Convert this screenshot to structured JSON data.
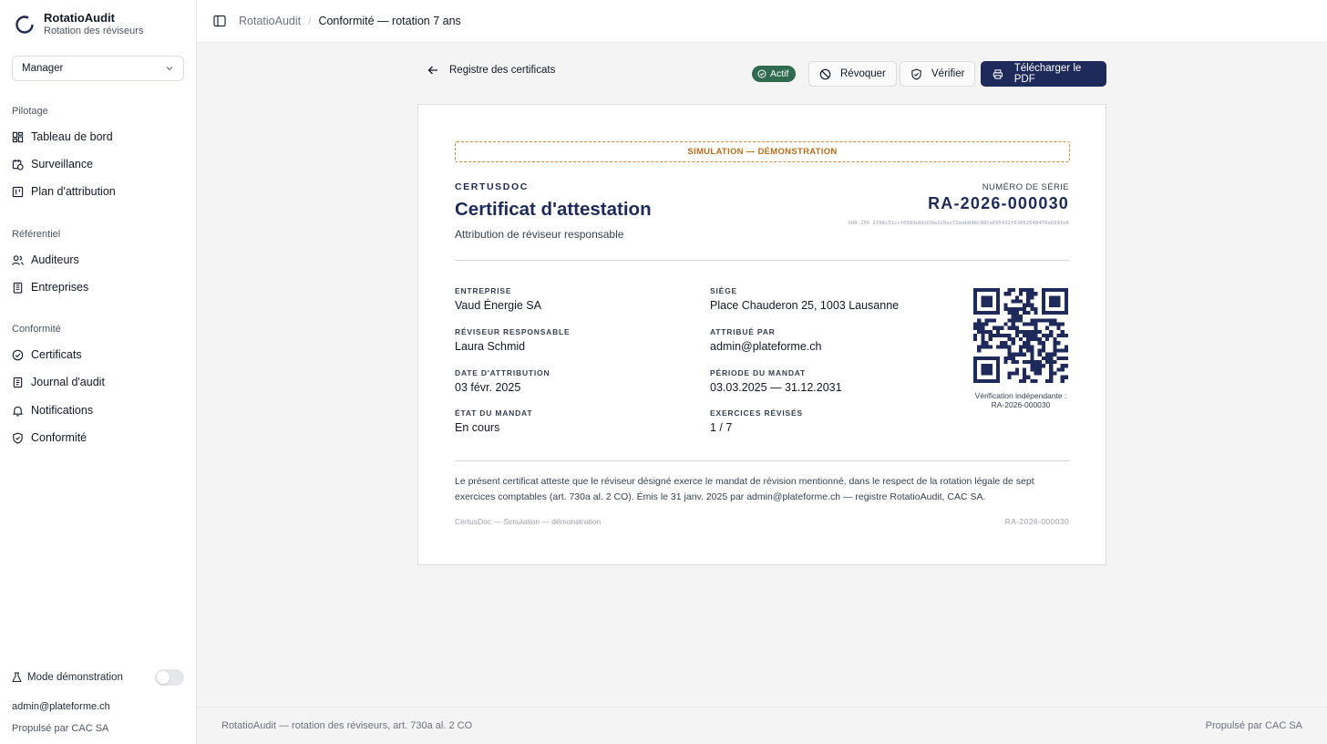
{
  "app": {
    "name": "RotatioAudit",
    "subtitle": "Rotation des réviseurs"
  },
  "role_select": {
    "value": "Manager"
  },
  "nav": {
    "sections": [
      {
        "label": "Pilotage",
        "items": [
          {
            "label": "Tableau de bord",
            "icon": "dashboard-icon"
          },
          {
            "label": "Surveillance",
            "icon": "calendar-clock-icon"
          },
          {
            "label": "Plan d'attribution",
            "icon": "board-icon"
          }
        ]
      },
      {
        "label": "Référentiel",
        "items": [
          {
            "label": "Auditeurs",
            "icon": "users-icon"
          },
          {
            "label": "Entreprises",
            "icon": "building-icon"
          }
        ]
      },
      {
        "label": "Conformité",
        "items": [
          {
            "label": "Certificats",
            "icon": "check-circle-icon"
          },
          {
            "label": "Journal d'audit",
            "icon": "scroll-icon"
          },
          {
            "label": "Notifications",
            "icon": "bell-icon"
          },
          {
            "label": "Conformité",
            "icon": "shield-check-icon"
          }
        ]
      }
    ]
  },
  "sidebar_footer": {
    "demo_label": "Mode démonstration",
    "demo_enabled": false,
    "email": "admin@plateforme.ch",
    "powered": "Propulsé par CAC SA"
  },
  "breadcrumb": {
    "root": "RotatioAudit",
    "current": "Conformité — rotation 7 ans"
  },
  "actions": {
    "back_label": "Registre des certificats",
    "status_badge": "Actif",
    "revoke_label": "Révoquer",
    "verify_label": "Vérifier",
    "download_label": "Télécharger le PDF"
  },
  "certificate": {
    "banner": "SIMULATION — DÉMONSTRATION",
    "brand": "CERTUSDOC",
    "title": "Certificat d'attestation",
    "subtitle": "Attribution de réviseur responsable",
    "serial_label": "NUMÉRO DE SÉRIE",
    "serial": "RA-2026-000030",
    "hash": "SHA-256 2f08c51ccf0983e6bd36e226ec72eab848c98fa695432f63662648476eb591e6",
    "fields": {
      "entreprise": {
        "label": "Entreprise",
        "value": "Vaud Énergie SA"
      },
      "siege": {
        "label": "Siège",
        "value": "Place Chauderon 25, 1003 Lausanne"
      },
      "reviseur": {
        "label": "Réviseur responsable",
        "value": "Laura Schmid"
      },
      "attribue_par": {
        "label": "Attribué par",
        "value": "admin@plateforme.ch"
      },
      "date": {
        "label": "Date d'attribution",
        "value": "03 févr. 2025"
      },
      "periode": {
        "label": "Période du mandat",
        "value": "03.03.2025 — 31.12.2031"
      },
      "etat": {
        "label": "État du mandat",
        "value": "En cours"
      },
      "exercices": {
        "label": "Exercices révisés",
        "value": "1 / 7"
      }
    },
    "qr_caption_line1": "Vérification indépendante :",
    "qr_caption_line2": "RA-2026-000030",
    "statement": "Le présent certificat atteste que le réviseur désigné exerce le mandat de révision mentionné, dans le respect de la rotation légale de sept exercices comptables (art. 730a al. 2 CO). Émis le 31 janv. 2025 par admin@plateforme.ch — registre RotatioAudit, CAC SA.",
    "footer_left": "CertusDoc — Simulation — démonstration",
    "footer_right": "RA-2026-000030"
  },
  "app_footer": {
    "left": "RotatioAudit — rotation des réviseurs, art. 730a al. 2 CO",
    "right": "Propulsé par CAC SA"
  },
  "colors": {
    "primary": "#1e2a5a",
    "success": "#2f6b4f",
    "warning": "#b56d1d"
  }
}
